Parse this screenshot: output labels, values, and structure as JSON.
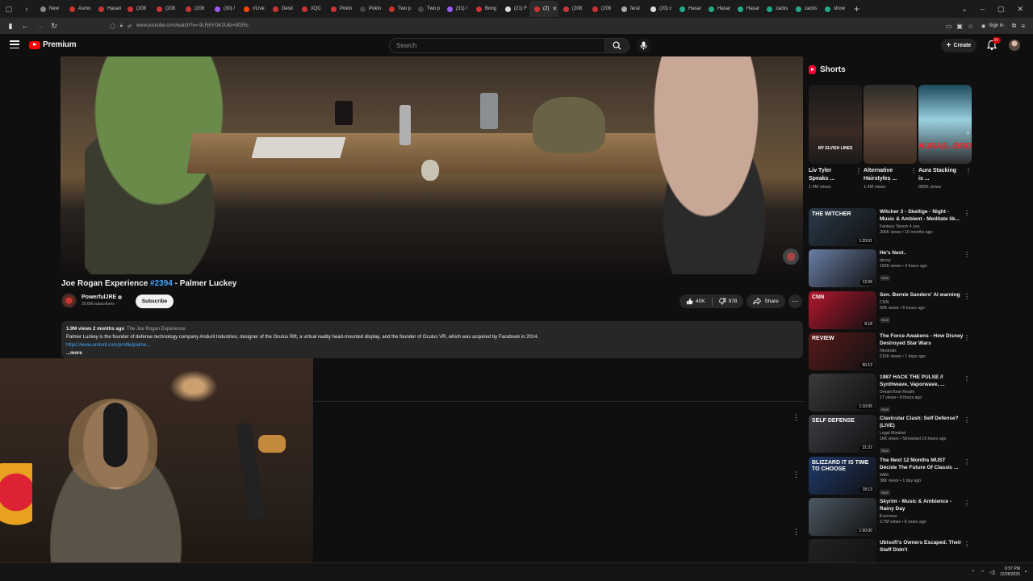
{
  "browser": {
    "tabs": [
      {
        "label": "New",
        "color": "#888"
      },
      {
        "label": "Asmo",
        "color": "#c33"
      },
      {
        "label": "Hasan",
        "color": "#c33"
      },
      {
        "label": "(208",
        "color": "#c33"
      },
      {
        "label": "(208",
        "color": "#c33"
      },
      {
        "label": "(208",
        "color": "#c33"
      },
      {
        "label": "(30) /",
        "color": "#9b5cf6"
      },
      {
        "label": "r/Live",
        "color": "#ff4500"
      },
      {
        "label": "Desti",
        "color": "#c33"
      },
      {
        "label": "XQC",
        "color": "#c33"
      },
      {
        "label": "Pokin",
        "color": "#c33"
      },
      {
        "label": "Pokin",
        "color": "#444"
      },
      {
        "label": "Two p",
        "color": "#c33"
      },
      {
        "label": "Two p",
        "color": "#444"
      },
      {
        "label": "(31) /",
        "color": "#9b5cf6"
      },
      {
        "label": "Bong",
        "color": "#c33"
      },
      {
        "label": "(21) F",
        "color": "#ddd"
      },
      {
        "label": "(2)",
        "color": "#c33",
        "active": true
      },
      {
        "label": "(208",
        "color": "#c33"
      },
      {
        "label": "(208",
        "color": "#c33"
      },
      {
        "label": "feral",
        "color": "#aaa"
      },
      {
        "label": "(20) c",
        "color": "#ddd"
      },
      {
        "label": "Hasar",
        "color": "#2a8"
      },
      {
        "label": "Hasar",
        "color": "#2a8"
      },
      {
        "label": "Hasar",
        "color": "#2a8"
      },
      {
        "label": "zacks",
        "color": "#2a8"
      },
      {
        "label": "zacks",
        "color": "#2a8"
      },
      {
        "label": "show",
        "color": "#2a8"
      }
    ],
    "new_tab_symbol": "+",
    "url": "www.youtube.com/watch?v=-9LFj6YOK2U&t=9035s",
    "sign_in": "Sign in"
  },
  "masthead": {
    "logo_text": "Premium",
    "search_placeholder": "Search",
    "create_label": "Create",
    "notif_count": "9+"
  },
  "video": {
    "title_prefix": "Joe Rogan Experience ",
    "title_hashtag": "#2394",
    "title_suffix": " - Palmer Luckey",
    "channel_name": "PowerfulJRE",
    "subscribers": "20.6M subscribers",
    "subscribe_label": "Subscribe",
    "likes": "40K",
    "dislikes": "978",
    "share_label": "Share"
  },
  "description": {
    "views_date": "1.9M views  2 months ago",
    "tag": "The Joe Rogan Experience",
    "text": "Palmer Luckey is the founder of defense technology company Anduril Industries, designer of the Oculus Rift, a virtual reality head-mounted display, and the founder of Oculus VR, which was acquired by Facebook in 2014.",
    "link": "https://www.anduril.com/profile/palme...",
    "more": "...more"
  },
  "shorts": {
    "header": "Shorts",
    "items": [
      {
        "title": "Liv Tyler Speaks ...",
        "views": "1.4M views",
        "thumb_text": "MY ELVISH LINES"
      },
      {
        "title": "Alternative Hairstyles ...",
        "views": "1.4M views",
        "thumb_text": ""
      },
      {
        "title": "Aura Stacking is ...",
        "views": "905K views",
        "thumb_text": "AURAS...BROKEN"
      }
    ]
  },
  "recommendations": [
    {
      "title": "Witcher 3 - Skellige - Night - Music & Ambient - Meditate lik...",
      "channel": "Fantasy Tavern 4 you",
      "meta": "306K views • 10 months ago",
      "duration": "1:20:01",
      "new": "",
      "thumb_bg": "#2b3a4a",
      "thumb_text": "THE WITCHER"
    },
    {
      "title": "He's Next..",
      "channel": "decoy",
      "meta": "193K views • 4 hours ago",
      "duration": "12:06",
      "new": "New",
      "thumb_bg": "#6a7fa6",
      "thumb_text": ""
    },
    {
      "title": "Sen. Bernie Sanders' AI warning",
      "channel": "CNN",
      "meta": "50K views • 5 hours ago",
      "duration": "8:18",
      "new": "New",
      "thumb_bg": "#b3162d",
      "thumb_text": "CNN"
    },
    {
      "title": "The Force Awakens - How Disney Destroyed Star Wars",
      "channel": "Nerdrotic",
      "meta": "515K views • 7 days ago",
      "duration": "50:13",
      "new": "",
      "thumb_bg": "#5a1a1a",
      "thumb_text": "REVIEW"
    },
    {
      "title": "1987 HACK THE PULSE // Synthwave, Vaporwave, ...",
      "channel": "DreamTone Realm",
      "meta": "17 views • 8 hours ago",
      "duration": "1:10:05",
      "new": "New",
      "thumb_bg": "#3a3a3a",
      "thumb_text": ""
    },
    {
      "title": "Clavicular Clash: Self Defense? (LIVE)",
      "channel": "Legal Mindset",
      "meta": "16K views • Streamed 19 hours ago",
      "duration": "31:22",
      "new": "New",
      "thumb_bg": "#3c3c44",
      "thumb_text": "SELF DEFENSE"
    },
    {
      "title": "The Next 12 Months MUST Decide The Future Of Classic ...",
      "channel": "Willit",
      "meta": "38K views • 1 day ago",
      "duration": "18:13",
      "new": "New",
      "thumb_bg": "#1f3a6a",
      "thumb_text": "BLIZZARD IT IS TIME TO CHOOSE"
    },
    {
      "title": "Skyrim - Music & Ambience - Rainy Day",
      "channel": "Everness",
      "meta": "3.7M views • 8 years ago",
      "duration": "1:00:00",
      "new": "",
      "thumb_bg": "#4c5863",
      "thumb_text": ""
    },
    {
      "title": "Ubisoft's Owners Escaped. Their Staff Didn't",
      "channel": "",
      "meta": "",
      "duration": "",
      "new": "",
      "thumb_bg": "#222",
      "thumb_text": ""
    }
  ],
  "taskbar": {
    "time": "6:57 PM",
    "date": "12/28/2025"
  }
}
